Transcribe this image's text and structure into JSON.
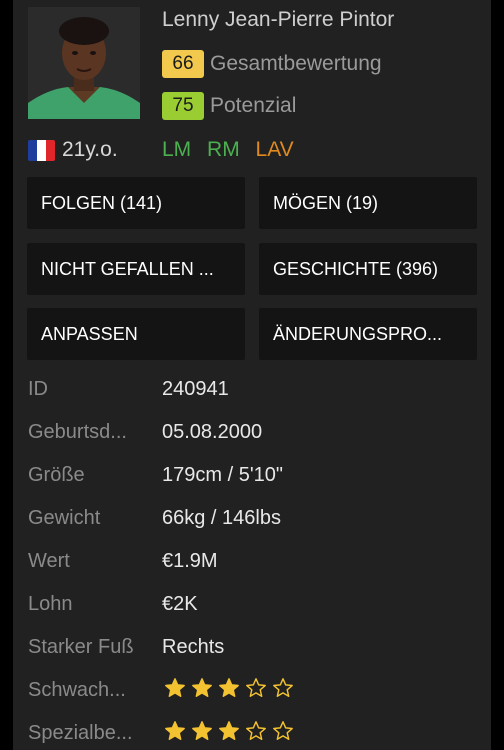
{
  "player": {
    "name": "Lenny Jean-Pierre Pintor",
    "overall": {
      "value": "66",
      "label": "Gesamtbewertung",
      "color": "#f2c94c"
    },
    "potential": {
      "value": "75",
      "label": "Potenzial",
      "color": "#9acd32"
    },
    "age": "21y.o.",
    "nationality_flag": "france-flag",
    "positions": [
      {
        "label": "LM",
        "color": "#4caf50"
      },
      {
        "label": "RM",
        "color": "#4caf50"
      },
      {
        "label": "LAV",
        "color": "#e08a1e"
      }
    ]
  },
  "actions": {
    "follow": "FOLGEN (141)",
    "like": "MÖGEN (19)",
    "dislike": "NICHT GEFALLEN ...",
    "history": "GESCHICHTE (396)",
    "customize": "ANPASSEN",
    "changes": "ÄNDERUNGSPRO..."
  },
  "info": [
    {
      "label": "ID",
      "value": "240941"
    },
    {
      "label": "Geburtsd...",
      "value": "05.08.2000"
    },
    {
      "label": "Größe",
      "value": "179cm / 5'10\""
    },
    {
      "label": "Gewicht",
      "value": "66kg / 146lbs"
    },
    {
      "label": "Wert",
      "value": "€1.9M"
    },
    {
      "label": "Lohn",
      "value": "€2K"
    },
    {
      "label": "Starker Fuß",
      "value": "Rechts"
    }
  ],
  "ratings": [
    {
      "label": "Schwach...",
      "stars": 3,
      "max": 5
    },
    {
      "label": "Spezialbe...",
      "stars": 3,
      "max": 5
    }
  ],
  "colors": {
    "star": "#f2c230",
    "background": "#212121",
    "button": "#141414"
  }
}
